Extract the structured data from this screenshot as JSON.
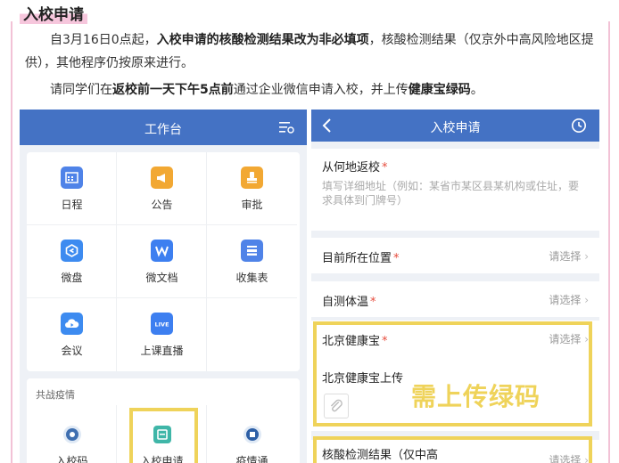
{
  "article": {
    "heading": "入校申请",
    "p1_a": "自3月16日0点起，",
    "p1_b": "入校申请的核酸检测结果改为非必填项",
    "p1_c": "，核酸检测结果（仅京外中高风险地区提供），其他程序仍按原来进行。",
    "p2_a": "请同学们在",
    "p2_b": "返校前一天下午5点前",
    "p2_c": "通过企业微信申请入校，并上传",
    "p2_d": "健康宝绿码",
    "p2_e": "。"
  },
  "workbench": {
    "title": "工作台",
    "apps": [
      {
        "label": "日程",
        "icon": "calendar-icon",
        "color": "#4f83e8"
      },
      {
        "label": "公告",
        "icon": "megaphone-icon",
        "color": "#f2a833"
      },
      {
        "label": "审批",
        "icon": "stamp-icon",
        "color": "#f2a833"
      },
      {
        "label": "微盘",
        "icon": "drive-icon",
        "color": "#3d8bf0"
      },
      {
        "label": "微文档",
        "icon": "doc-w-icon",
        "color": "#3d7ff0"
      },
      {
        "label": "收集表",
        "icon": "form-icon",
        "color": "#4f83e8"
      },
      {
        "label": "会议",
        "icon": "cloud-meeting-icon",
        "color": "#3d8bf0"
      },
      {
        "label": "上课直播",
        "icon": "live-icon",
        "color": "#3d7ff0"
      }
    ],
    "section_title": "共战疫情",
    "section_apps": [
      {
        "label": "入校码",
        "icon": "qr-icon"
      },
      {
        "label": "入校申请",
        "icon": "school-apply-icon"
      },
      {
        "label": "疫情通",
        "icon": "epidemic-icon"
      }
    ]
  },
  "apply_form": {
    "title": "入校申请",
    "from_label": "从何地返校",
    "from_placeholder": "填写详细地址（例如：某省市某区县某机构或住址，要求具体到门牌号）",
    "location_label": "目前所在位置",
    "temp_label": "自测体温",
    "health_label": "北京健康宝",
    "upload_label": "北京健康宝上传",
    "upload_note": "需上传绿码",
    "nucleic_label": "核酸检测结果（仅中高",
    "select_text": "请选择",
    "required_mark": "*"
  },
  "colors": {
    "header_blue": "#4472c4",
    "highlight_yellow": "#efd35a",
    "required_red": "#e64b3c",
    "border_pink": "#f2c2d6"
  }
}
